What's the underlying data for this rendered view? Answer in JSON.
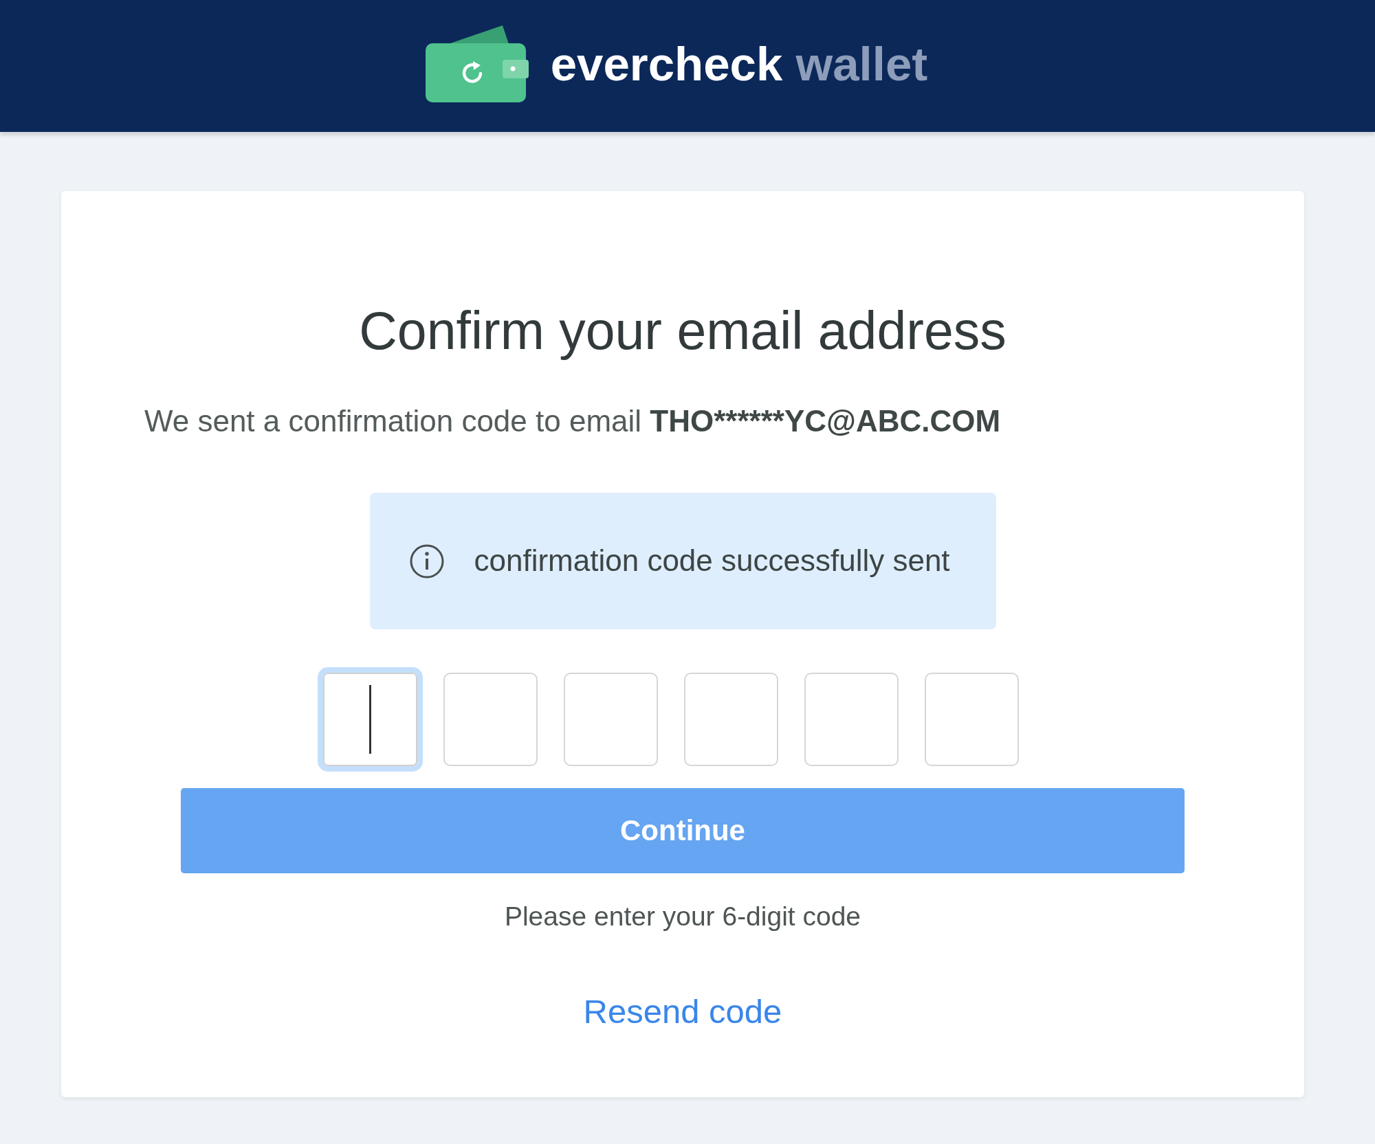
{
  "header": {
    "logo": {
      "primary": "evercheck",
      "secondary": "wallet"
    }
  },
  "card": {
    "title": "Confirm your email address",
    "message": {
      "text": "We sent a confirmation code to email",
      "email": "THO******YC@ABC.COM"
    },
    "notice": {
      "kind": "info",
      "text": "confirmation code successfully sent"
    },
    "code_inputs": [
      {
        "focused": true
      },
      {
        "focused": false
      },
      {
        "focused": false
      },
      {
        "focused": false
      },
      {
        "focused": false
      },
      {
        "focused": false
      }
    ],
    "continue_button": {
      "label": "Continue"
    },
    "hint": "Please enter your 6-digit code",
    "resend_link": "Resend code"
  }
}
